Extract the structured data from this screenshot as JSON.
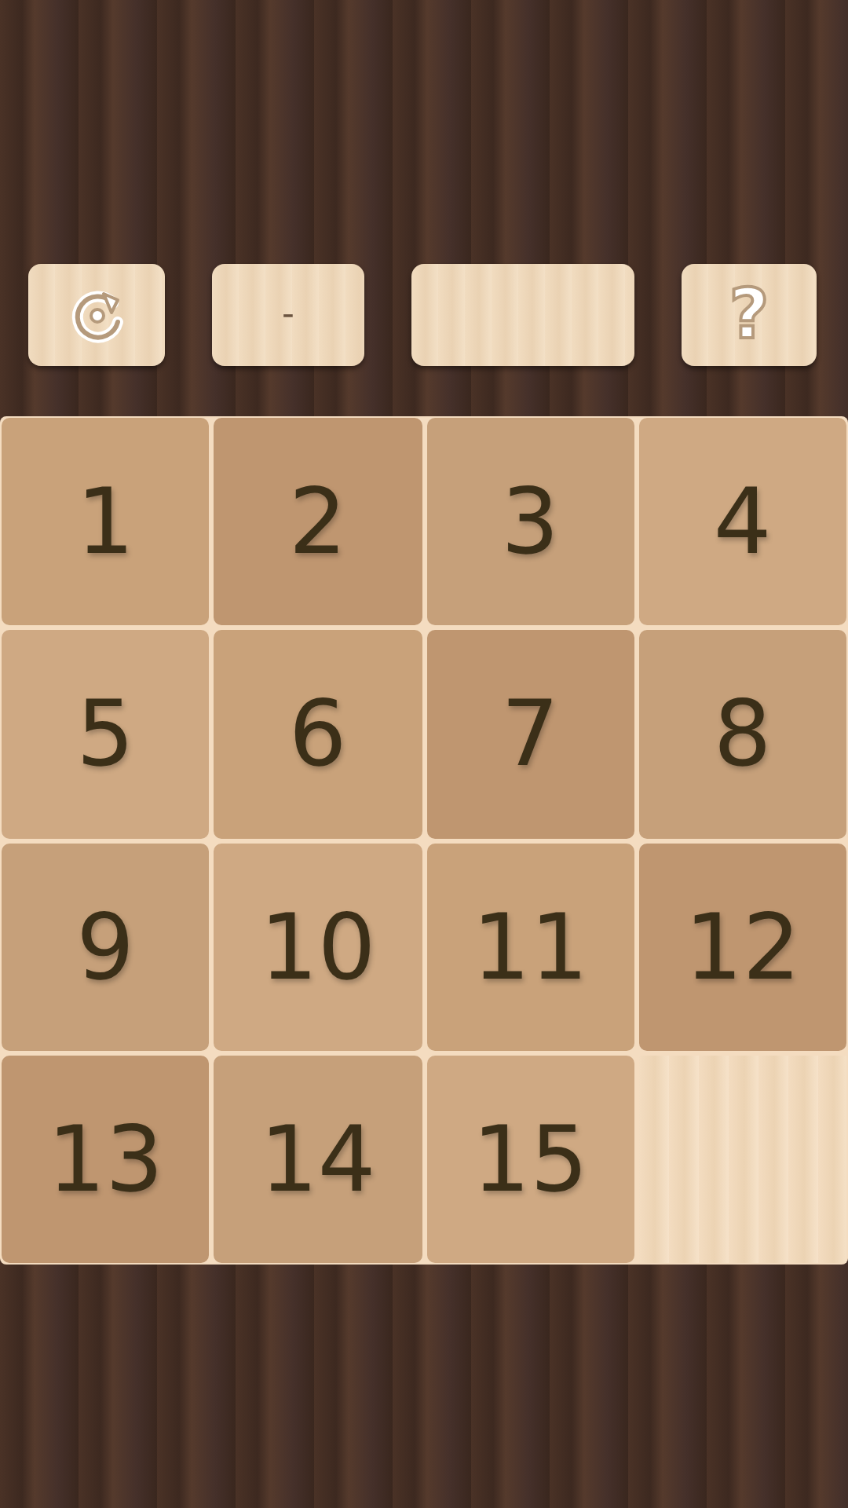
{
  "toolbar": {
    "counter": "-",
    "help": "?"
  },
  "board": {
    "tiles": [
      {
        "kind": "number",
        "label": "1"
      },
      {
        "kind": "number",
        "label": "2"
      },
      {
        "kind": "number",
        "label": "3"
      },
      {
        "kind": "number",
        "label": "4"
      },
      {
        "kind": "number",
        "label": "5"
      },
      {
        "kind": "number",
        "label": "6"
      },
      {
        "kind": "number",
        "label": "7"
      },
      {
        "kind": "number",
        "label": "8"
      },
      {
        "kind": "number",
        "label": "9"
      },
      {
        "kind": "number",
        "label": "10"
      },
      {
        "kind": "number",
        "label": "11"
      },
      {
        "kind": "number",
        "label": "12"
      },
      {
        "kind": "number",
        "label": "13"
      },
      {
        "kind": "number",
        "label": "14"
      },
      {
        "kind": "number",
        "label": "15"
      },
      {
        "kind": "empty"
      }
    ]
  }
}
